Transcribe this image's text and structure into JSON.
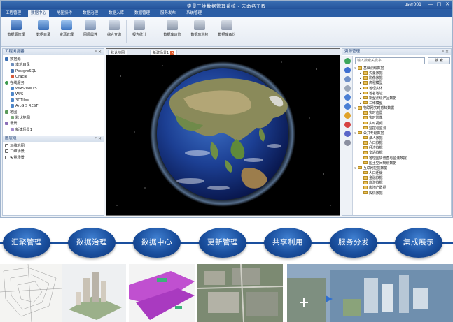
{
  "window": {
    "title": "实景三维数据管理系统 - 未命名工程",
    "user": "user001",
    "min_label": "—",
    "max_label": "□",
    "close_label": "✕"
  },
  "menu": [
    "工程管理",
    "数据中心",
    "地图操作",
    "数据治理",
    "数据入库",
    "数据管理",
    "服务发布",
    "系统管理"
  ],
  "ribbon": [
    "数据源管理",
    "数据目录",
    "资源管理",
    "图层属性",
    "综合查询",
    "报告统计",
    "数据库运管",
    "数据库巡检",
    "数据库备份"
  ],
  "left_panel": {
    "header": "工程浏览器",
    "tree": [
      "数据源",
      "本地目录",
      "PostgreSQL",
      "Oracle",
      "在线服务",
      "WMS/WMTS",
      "WFS",
      "3DTiles",
      "ArcGIS REST",
      "地图",
      "默认地图",
      "场景",
      "新建场景1"
    ],
    "layers_header": "图层组",
    "layers": [
      "三维地图",
      "二维场景",
      "矢量场景"
    ]
  },
  "map": {
    "tabs": [
      "默认地图",
      "新建场景1"
    ]
  },
  "right_panel": {
    "header": "资源管理",
    "search_placeholder": "输入搜索关键字",
    "search_button": "搜 索",
    "tree": [
      "基础测绘数据",
      "矢量数据",
      "影像数据",
      "高程模型",
      "地理实体",
      "地名地址",
      "新型测绘产品数据",
      "三维模型",
      "物联网实时感知数据",
      "实时位置",
      "实时影像",
      "实时视频",
      "监控与监测",
      "公共专题数据",
      "法人数据",
      "人口数据",
      "经济数据",
      "交通数据",
      "地理国情普查与监测数据",
      "国土空间规划数据",
      "互联网挖掘数据",
      "人口迁徙",
      "金融数据",
      "旅游数据",
      "房地产数据",
      "舆情数据"
    ]
  },
  "pipeline": [
    "汇聚管理",
    "数据治理",
    "数据中心",
    "更新管理",
    "共享利用",
    "服务分发",
    "集成展示"
  ],
  "colors": {
    "accent": "#2c5ea5",
    "bubble": "#1a4f9e",
    "folder": "#e9c05a"
  }
}
